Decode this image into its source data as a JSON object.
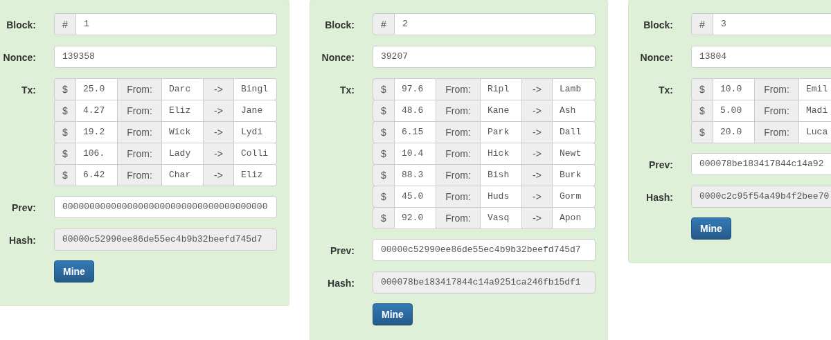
{
  "blocks": [
    {
      "block_label": "Block:",
      "block_prefix": "#",
      "block": "1",
      "nonce_label": "Nonce:",
      "nonce": "139358",
      "tx_label": "Tx:",
      "tx": [
        {
          "currency": "$",
          "amount": "25.0",
          "from_label": "From:",
          "from": "Darc",
          "arrow": "->",
          "to": "Bingl"
        },
        {
          "currency": "$",
          "amount": "4.27",
          "from_label": "From:",
          "from": "Eliz",
          "arrow": "->",
          "to": "Jane"
        },
        {
          "currency": "$",
          "amount": "19.2",
          "from_label": "From:",
          "from": "Wick",
          "arrow": "->",
          "to": "Lydi"
        },
        {
          "currency": "$",
          "amount": "106.",
          "from_label": "From:",
          "from": "Lady",
          "arrow": "->",
          "to": "Colli"
        },
        {
          "currency": "$",
          "amount": "6.42",
          "from_label": "From:",
          "from": "Char",
          "arrow": "->",
          "to": "Eliz"
        }
      ],
      "prev_label": "Prev:",
      "prev": "00000000000000000000000000000000000000",
      "hash_label": "Hash:",
      "hash": "00000c52990ee86de55ec4b9b32beefd745d7",
      "button": "Mine"
    },
    {
      "block_label": "Block:",
      "block_prefix": "#",
      "block": "2",
      "nonce_label": "Nonce:",
      "nonce": "39207",
      "tx_label": "Tx:",
      "tx": [
        {
          "currency": "$",
          "amount": "97.6",
          "from_label": "From:",
          "from": "Ripl",
          "arrow": "->",
          "to": "Lamb"
        },
        {
          "currency": "$",
          "amount": "48.6",
          "from_label": "From:",
          "from": "Kane",
          "arrow": "->",
          "to": "Ash"
        },
        {
          "currency": "$",
          "amount": "6.15",
          "from_label": "From:",
          "from": "Park",
          "arrow": "->",
          "to": "Dall"
        },
        {
          "currency": "$",
          "amount": "10.4",
          "from_label": "From:",
          "from": "Hick",
          "arrow": "->",
          "to": "Newt"
        },
        {
          "currency": "$",
          "amount": "88.3",
          "from_label": "From:",
          "from": "Bish",
          "arrow": "->",
          "to": "Burk"
        },
        {
          "currency": "$",
          "amount": "45.0",
          "from_label": "From:",
          "from": "Huds",
          "arrow": "->",
          "to": "Gorm"
        },
        {
          "currency": "$",
          "amount": "92.0",
          "from_label": "From:",
          "from": "Vasq",
          "arrow": "->",
          "to": "Apon"
        }
      ],
      "prev_label": "Prev:",
      "prev": "00000c52990ee86de55ec4b9b32beefd745d7",
      "hash_label": "Hash:",
      "hash": "000078be183417844c14a9251ca246fb15df1",
      "button": "Mine"
    },
    {
      "block_label": "Block:",
      "block_prefix": "#",
      "block": "3",
      "nonce_label": "Nonce:",
      "nonce": "13804",
      "tx_label": "Tx:",
      "tx": [
        {
          "currency": "$",
          "amount": "10.0",
          "from_label": "From:",
          "from": "Emil"
        },
        {
          "currency": "$",
          "amount": "5.00",
          "from_label": "From:",
          "from": "Madi"
        },
        {
          "currency": "$",
          "amount": "20.0",
          "from_label": "From:",
          "from": "Luca"
        }
      ],
      "prev_label": "Prev:",
      "prev": "000078be183417844c14a92",
      "hash_label": "Hash:",
      "hash": "0000c2c95f54a49b4f2bee70",
      "button": "Mine"
    }
  ]
}
